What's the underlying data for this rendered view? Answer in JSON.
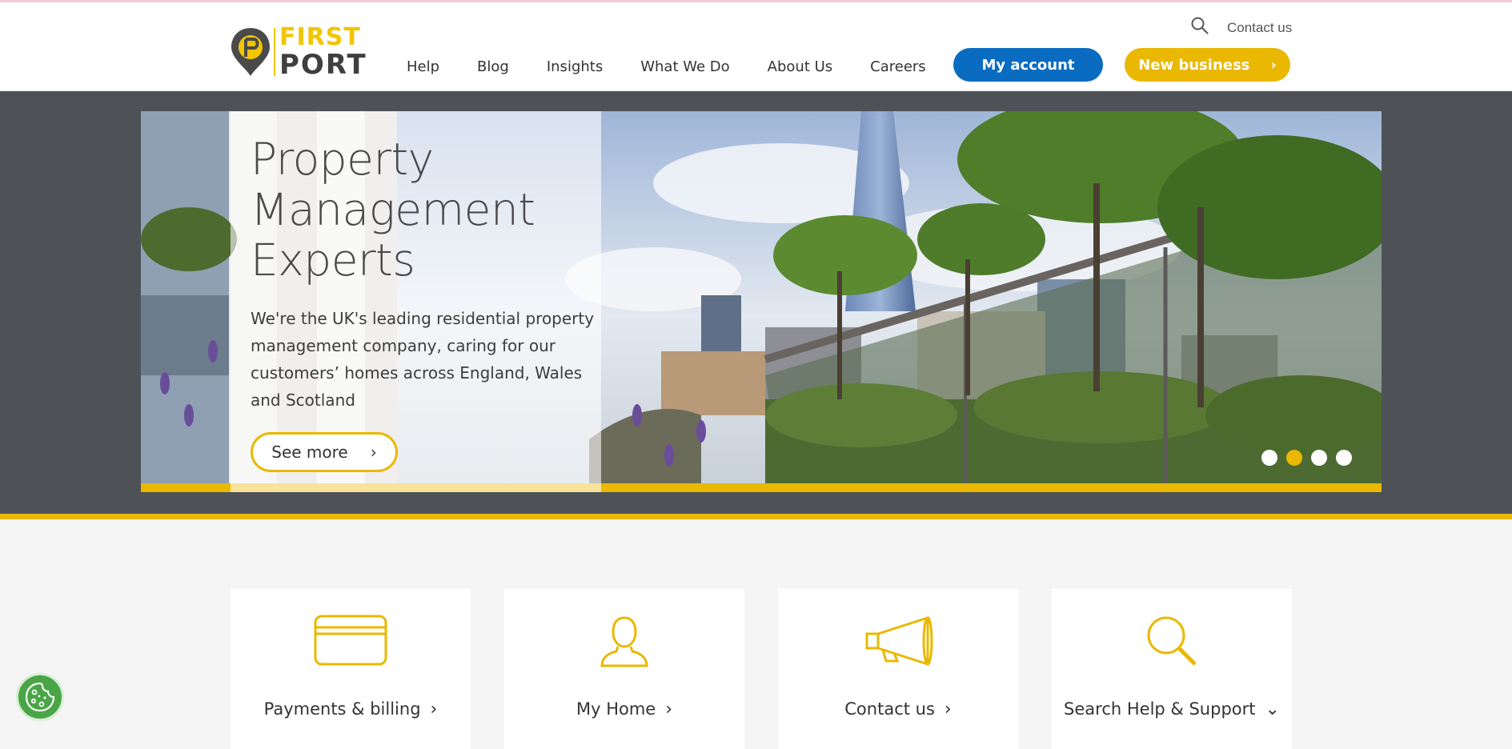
{
  "header": {
    "logo": {
      "first": "FIRST",
      "port": "PORT"
    },
    "contact_link": "Contact us",
    "nav": [
      "Help",
      "Blog",
      "Insights",
      "What We Do",
      "About Us",
      "Careers"
    ],
    "my_account": "My account",
    "new_business": "New business",
    "chevron": "›"
  },
  "hero": {
    "title": "Property Management Experts",
    "text": "We're the UK's leading residential property management company, caring for our customers’ homes across England, Wales and Scotland",
    "cta": "See more",
    "chevron": "›",
    "dots_count": 4,
    "active_dot": 1
  },
  "cards": [
    {
      "label": "Payments & billing",
      "icon": "credit-card-icon",
      "chevron": "›"
    },
    {
      "label": "My Home",
      "icon": "person-icon",
      "chevron": "›"
    },
    {
      "label": "Contact us",
      "icon": "megaphone-icon",
      "chevron": "›"
    },
    {
      "label": "Search Help & Support",
      "icon": "search-icon",
      "chevron": "⌄"
    }
  ],
  "colors": {
    "accent_yellow": "#eab800",
    "account_blue": "#0a6cc1",
    "hero_grey": "#4e5257"
  }
}
